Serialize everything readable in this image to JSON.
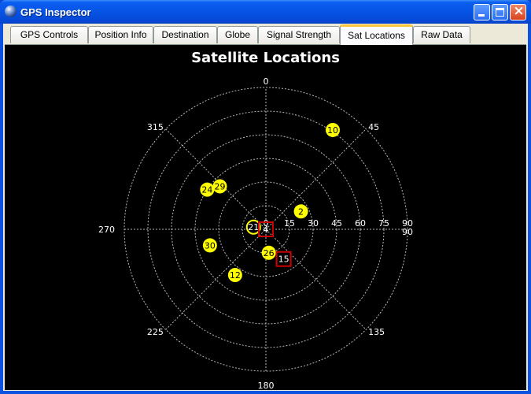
{
  "window": {
    "title": "GPS Inspector",
    "buttons": {
      "minimize": "minimize",
      "maximize": "maximize",
      "close": "×"
    }
  },
  "tabs": [
    {
      "label": "GPS Controls"
    },
    {
      "label": "Position Info"
    },
    {
      "label": "Destination"
    },
    {
      "label": "Globe"
    },
    {
      "label": "Signal Strength"
    },
    {
      "label": "Sat Locations",
      "active": true
    },
    {
      "label": "Raw Data"
    }
  ],
  "colors": {
    "satellite_fill": "#ffff00",
    "satellite_marked_border": "#cc0000",
    "grid": "#b8b8b8",
    "background": "#000000",
    "label": "#ffffff"
  },
  "chart_data": {
    "type": "polar-sky-plot",
    "title": "Satellite Locations",
    "azimuth_labels": [
      "0",
      "45",
      "135",
      "180",
      "225",
      "270",
      "315"
    ],
    "elevation_ticks": [
      "0",
      "15",
      "30",
      "45",
      "60",
      "75",
      "90"
    ],
    "elevation_end_label": "90",
    "satellites": [
      {
        "id": "10",
        "azimuth": 34,
        "elevation": 14,
        "shape": "circle"
      },
      {
        "id": "29",
        "azimuth": 313,
        "elevation": 50,
        "shape": "circle"
      },
      {
        "id": "24",
        "azimuth": 304,
        "elevation": 45,
        "shape": "circle"
      },
      {
        "id": "2",
        "azimuth": 63,
        "elevation": 65,
        "shape": "circle"
      },
      {
        "id": "21",
        "azimuth": 280,
        "elevation": 82,
        "shape": "ring"
      },
      {
        "id": "4",
        "azimuth": 0,
        "elevation": 90,
        "shape": "square"
      },
      {
        "id": "30",
        "azimuth": 254,
        "elevation": 53,
        "shape": "circle"
      },
      {
        "id": "26",
        "azimuth": 173,
        "elevation": 75,
        "shape": "circle"
      },
      {
        "id": "15",
        "azimuth": 149,
        "elevation": 68,
        "shape": "square"
      },
      {
        "id": "12",
        "azimuth": 214,
        "elevation": 55,
        "shape": "circle"
      }
    ]
  }
}
